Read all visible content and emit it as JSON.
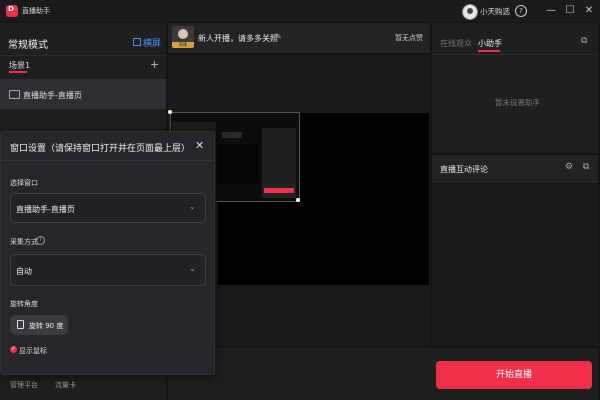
{
  "titlebar": {
    "app_logo_text": "D",
    "app_title": "直播助手",
    "user_name": "小天购选",
    "icons": [
      "help-icon",
      "minimize-icon",
      "maximize-icon",
      "close-icon"
    ],
    "help_glyph": "?",
    "minimize_glyph": "—",
    "maximize_glyph": "☐",
    "close_glyph": "✕"
  },
  "left_panel": {
    "mode_title": "常规模式",
    "landscape_toggle": "横屏",
    "scene_label": "场景1",
    "scene_add": "+",
    "source_item": "直播助手-直播页",
    "footer": {
      "manage_platform": "管理平台",
      "traffic_card": "流量卡"
    }
  },
  "center": {
    "stream_title": "新人开播，请多多关照",
    "stream_cover_badge": "直播",
    "edit_glyph": "✎",
    "likes_label": "暂无点赞"
  },
  "right_panel": {
    "tabs": [
      {
        "label": "在线观众",
        "active": false
      },
      {
        "label": "小助手",
        "active": true
      }
    ],
    "assistant_empty": "暂未设置助手",
    "comments_title": "直播互动评论",
    "gear_glyph": "⚙",
    "popout_glyph": "⧉",
    "start_button": "开始直播"
  },
  "dialog": {
    "title": "窗口设置（请保持窗口打开并在页面最上层）",
    "close_glyph": "✕",
    "window_label": "选择窗口",
    "window_value": "直播助手-直播页",
    "capture_label": "采集方式",
    "info_glyph": "i",
    "capture_value": "自动",
    "rotate_label": "旋转角度",
    "rotate_button": "旋转 90 度",
    "arrow_glyph": "⌄",
    "mouse_label": "显示鼠标",
    "mouse_checked": true,
    "check_glyph": "✓"
  },
  "colors": {
    "accent": "#f0304a",
    "link": "#4a8df8",
    "background": "#141414"
  }
}
